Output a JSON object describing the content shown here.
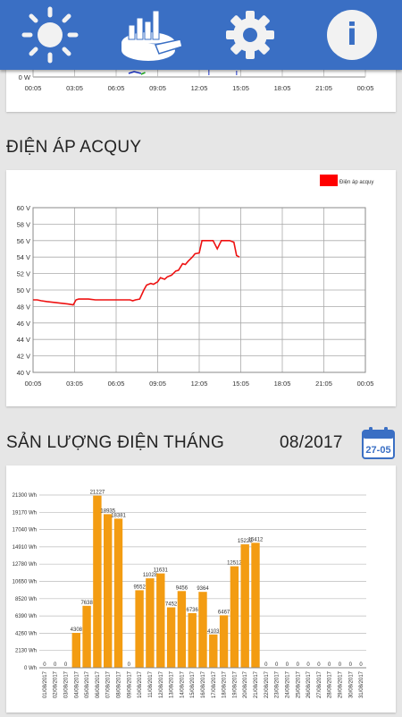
{
  "nav": {
    "tabs": [
      {
        "name": "sun",
        "icon": "sun-icon",
        "active": false
      },
      {
        "name": "stats",
        "icon": "chart-icon",
        "active": true
      },
      {
        "name": "settings",
        "icon": "gear-icon",
        "active": false
      },
      {
        "name": "info",
        "icon": "info-icon",
        "active": false
      }
    ],
    "info_glyph": "i"
  },
  "power_chart": {
    "y_label": "0 W",
    "x_ticks": [
      "00:05",
      "03:05",
      "06:05",
      "09:05",
      "12:05",
      "15:05",
      "18:05",
      "21:05",
      "00:05"
    ]
  },
  "battery": {
    "title": "ĐIỆN ÁP ACQUY",
    "chart_data": {
      "type": "line",
      "title": "",
      "legend": "Điện áp acquy",
      "legend_color": "#ff0000",
      "y_ticks": [
        "40 V",
        "42 V",
        "44 V",
        "46 V",
        "48 V",
        "50 V",
        "52 V",
        "54 V",
        "56 V",
        "58 V",
        "60 V"
      ],
      "ylim": [
        40,
        60
      ],
      "x_ticks": [
        "00:05",
        "03:05",
        "06:05",
        "09:05",
        "12:05",
        "15:05",
        "18:05",
        "21:05",
        "00:05"
      ],
      "xlim": [
        0,
        24
      ],
      "x": [
        0.0,
        0.3,
        0.6,
        1.0,
        1.5,
        2.0,
        2.5,
        2.9,
        3.1,
        3.3,
        3.7,
        4.0,
        4.5,
        5.0,
        5.5,
        6.0,
        6.5,
        7.0,
        7.2,
        7.4,
        7.7,
        8.0,
        8.2,
        8.5,
        8.7,
        9.0,
        9.2,
        9.5,
        9.7,
        10.0,
        10.3,
        10.5,
        10.8,
        11.0,
        11.2,
        11.5,
        11.7,
        12.0,
        12.2,
        12.4,
        12.6,
        12.8,
        13.0,
        13.3,
        13.6,
        13.9,
        14.2,
        14.5,
        14.7,
        14.9
      ],
      "y": [
        48.8,
        48.8,
        48.7,
        48.6,
        48.5,
        48.4,
        48.3,
        48.2,
        48.8,
        48.9,
        48.9,
        48.9,
        48.8,
        48.8,
        48.8,
        48.8,
        48.8,
        48.8,
        48.7,
        48.8,
        48.9,
        50.0,
        50.6,
        50.8,
        50.7,
        51.0,
        51.5,
        51.3,
        51.6,
        51.8,
        52.3,
        52.4,
        53.2,
        53.1,
        53.5,
        54.0,
        54.4,
        54.5,
        56.0,
        56.0,
        56.0,
        56.0,
        56.0,
        55.0,
        56.0,
        56.0,
        56.0,
        55.8,
        54.2,
        54.0
      ],
      "color": "#ee1111"
    }
  },
  "monthly": {
    "title": "SẢN LƯỢNG ĐIỆN THÁNG",
    "month": "08/2017",
    "calendar_label": "27-05",
    "chart_data": {
      "type": "bar",
      "title": "",
      "y_ticks": [
        "0 Wh",
        "2130 Wh",
        "4260 Wh",
        "6390 Wh",
        "8520 Wh",
        "10650 Wh",
        "12780 Wh",
        "14910 Wh",
        "17040 Wh",
        "19170 Wh",
        "21300 Wh"
      ],
      "ylim": [
        0,
        21300
      ],
      "categories": [
        "01/08/2017",
        "02/08/2017",
        "03/08/2017",
        "04/08/2017",
        "05/08/2017",
        "06/08/2017",
        "07/08/2017",
        "08/08/2017",
        "09/08/2017",
        "10/08/2017",
        "11/08/2017",
        "12/08/2017",
        "13/08/2017",
        "14/08/2017",
        "15/08/2017",
        "16/08/2017",
        "17/08/2017",
        "18/08/2017",
        "19/08/2017",
        "20/08/2017",
        "21/08/2017",
        "22/08/2017",
        "23/08/2017",
        "24/08/2017",
        "25/08/2017",
        "26/08/2017",
        "27/08/2017",
        "28/08/2017",
        "29/08/2017",
        "30/08/2017",
        "31/08/2017"
      ],
      "values": [
        0,
        0,
        0,
        4308,
        7638,
        21227,
        18935,
        18381,
        0,
        9552,
        11028,
        11631,
        7452,
        9456,
        6736,
        9364,
        4103,
        6467,
        12512,
        15223,
        15412,
        0,
        0,
        0,
        0,
        0,
        0,
        0,
        0,
        0,
        0
      ],
      "labels": [
        "0",
        "0",
        "0",
        "4308",
        "7638",
        "21227",
        "18935",
        "18381",
        "0",
        "9552",
        "11028",
        "11631",
        "7452",
        "9456",
        "6736",
        "9364",
        "4103",
        "6467",
        "12512",
        "15223",
        "15412",
        "0",
        "0",
        "0",
        "0",
        "0",
        "0",
        "0",
        "0",
        "0",
        "0"
      ],
      "color": "#f39c12"
    }
  }
}
